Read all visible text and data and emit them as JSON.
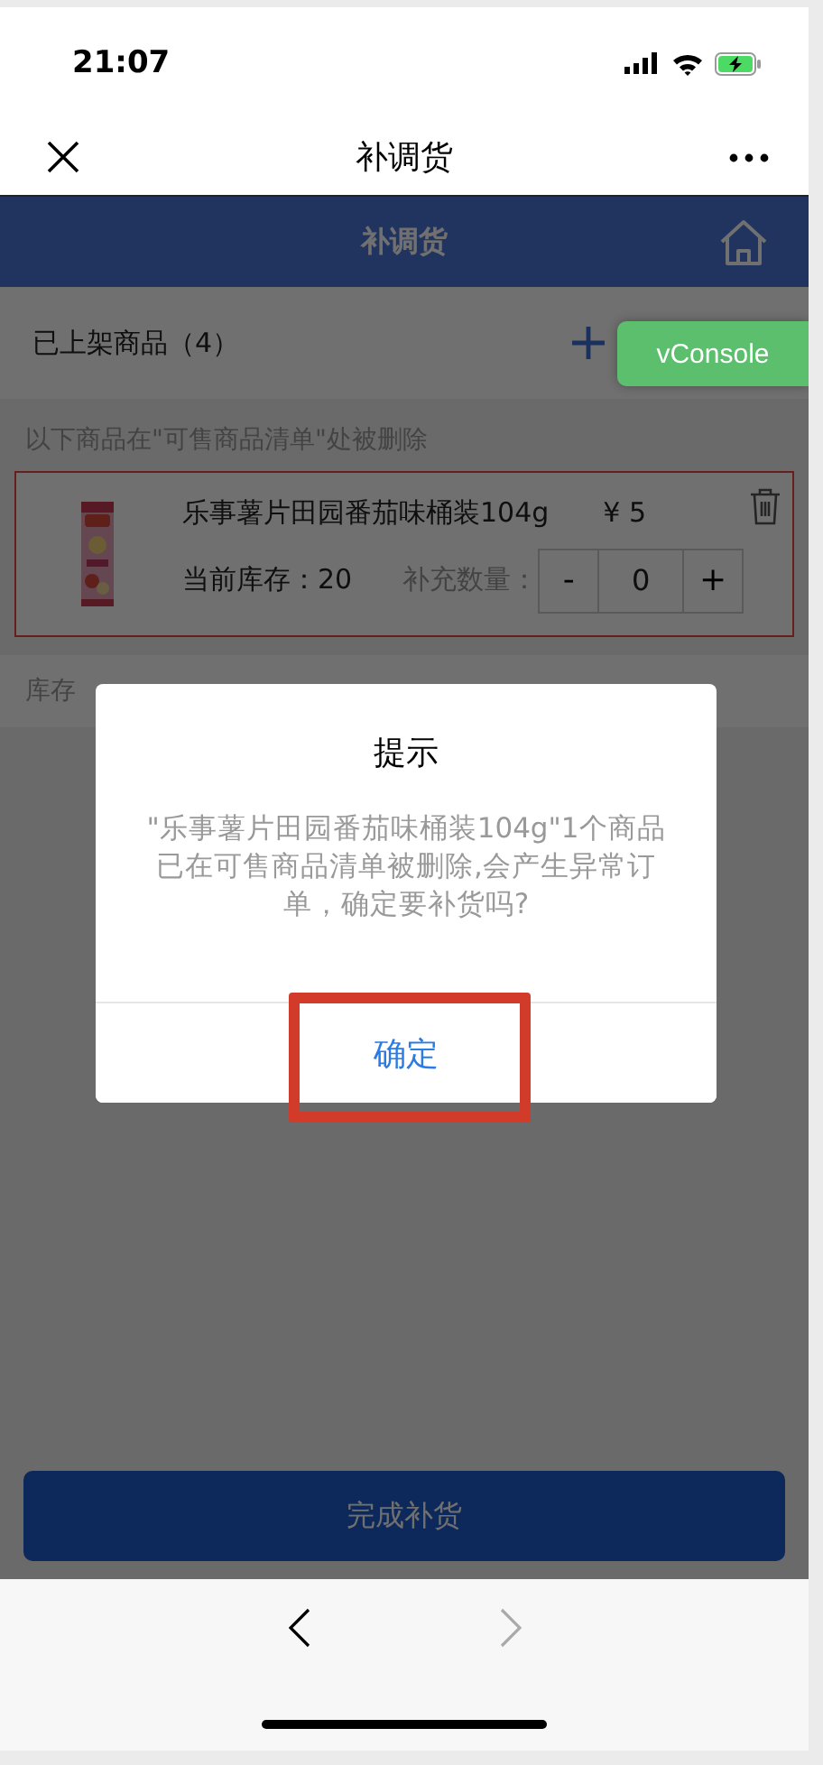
{
  "status_bar": {
    "time": "21:07"
  },
  "nav": {
    "title": "补调货"
  },
  "header": {
    "title": "补调货"
  },
  "listed": {
    "label": "已上架商品（4）"
  },
  "vconsole": {
    "label": "vConsole"
  },
  "deleted_notice": "以下商品在\"可售商品清单\"处被删除",
  "items": [
    {
      "name": "乐事薯片田园番茄味桶装104g",
      "price": "¥ 5",
      "stock": "当前库存：20",
      "qty_label": "补充数量：",
      "minus": "-",
      "qty": "0",
      "plus": "+"
    }
  ],
  "stock_row": "库存",
  "complete_button": "完成补货",
  "dialog": {
    "title": "提示",
    "message": "\"乐事薯片田园番茄味桶装104g\"1个商品已在可售商品清单被删除,会产生异常订单，确定要补货吗?",
    "confirm": "确定",
    "highlighted": true
  }
}
